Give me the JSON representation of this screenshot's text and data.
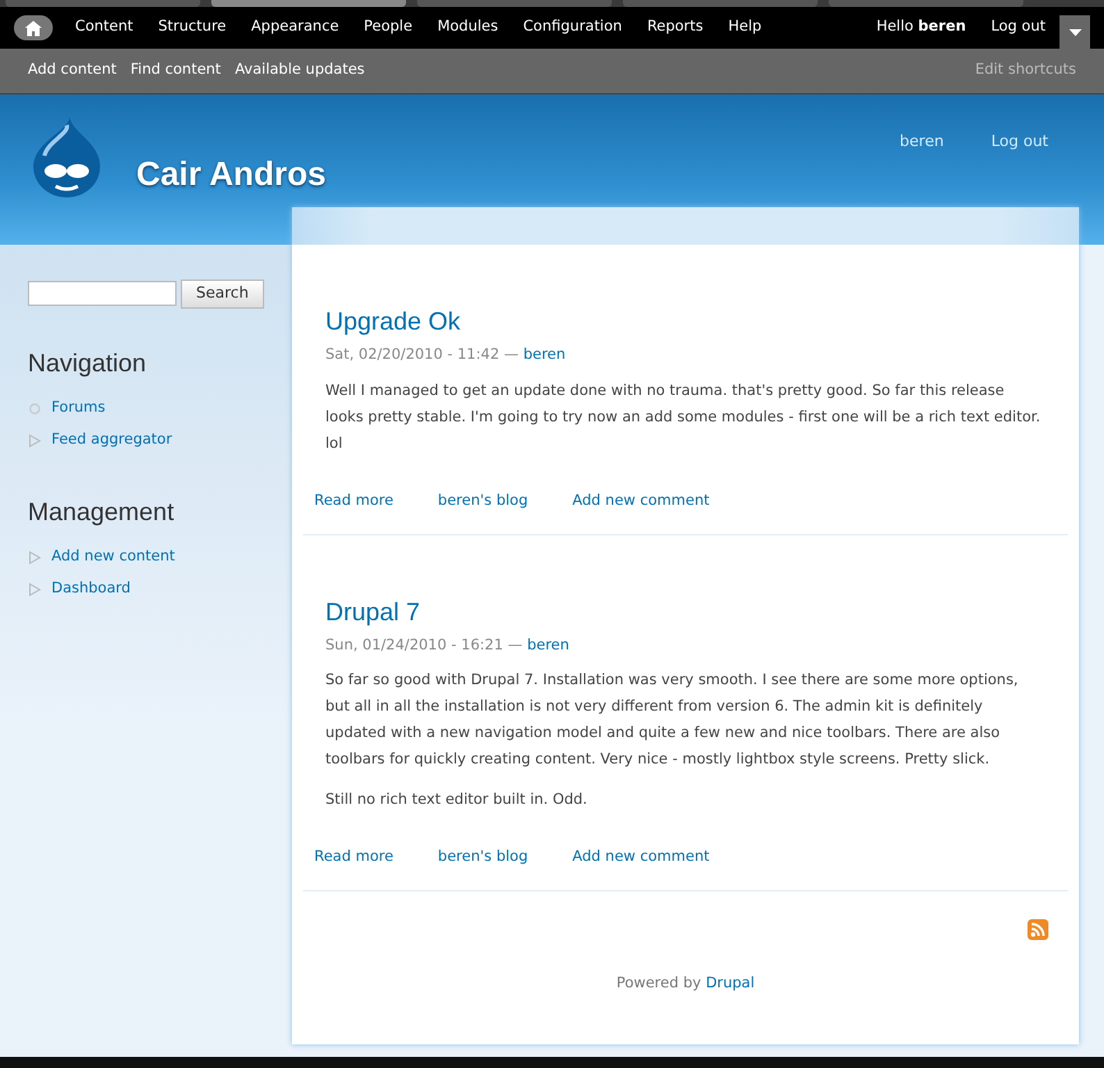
{
  "browser_tabs": [
    {
      "selected": false
    },
    {
      "selected": true
    },
    {
      "selected": false
    },
    {
      "selected": false
    },
    {
      "selected": false
    }
  ],
  "toolbar": {
    "menu": [
      "Content",
      "Structure",
      "Appearance",
      "People",
      "Modules",
      "Configuration",
      "Reports",
      "Help"
    ],
    "greeting": "Hello **beren**",
    "logout": "Log out"
  },
  "shortcuts": {
    "items": [
      "Add content",
      "Find content",
      "Available updates"
    ],
    "edit": "Edit shortcuts"
  },
  "header": {
    "site_name": "Cair Andros",
    "user_links": [
      "beren",
      "Log out"
    ]
  },
  "sidebar": {
    "search_button": "Search",
    "blocks": [
      {
        "title": "Navigation",
        "items": [
          {
            "label": "Forums",
            "kind": "leaf"
          },
          {
            "label": "Feed aggregator",
            "kind": "collapsed"
          }
        ]
      },
      {
        "title": "Management",
        "items": [
          {
            "label": "Add new content",
            "kind": "collapsed"
          },
          {
            "label": "Dashboard",
            "kind": "collapsed"
          }
        ]
      }
    ]
  },
  "posts": [
    {
      "title": "Upgrade Ok",
      "submitted": "Sat, 02/20/2010 - 11:42 —",
      "author": "beren",
      "paragraphs": [
        "Well I managed to get an update done with no trauma. that's pretty good. So far this release looks pretty stable. I'm going to try now an add some modules - first one will be a rich text editor. lol"
      ],
      "links": [
        "Read more",
        "beren's blog",
        "Add new comment"
      ]
    },
    {
      "title": "Drupal 7",
      "submitted": "Sun, 01/24/2010 - 16:21 —",
      "author": "beren",
      "paragraphs": [
        "So far so good with Drupal 7. Installation was very smooth. I see there are some more options, but all in all the installation is not very different from version 6. The admin kit is definitely updated with a new navigation model and quite a few new and nice toolbars. There are also toolbars for quickly creating content. Very nice - mostly lightbox style screens. Pretty slick.",
        "Still no rich text editor built in. Odd."
      ],
      "links": [
        "Read more",
        "beren's blog",
        "Add new comment"
      ]
    }
  ],
  "footer": {
    "powered_by": "Powered by",
    "link": "Drupal"
  }
}
